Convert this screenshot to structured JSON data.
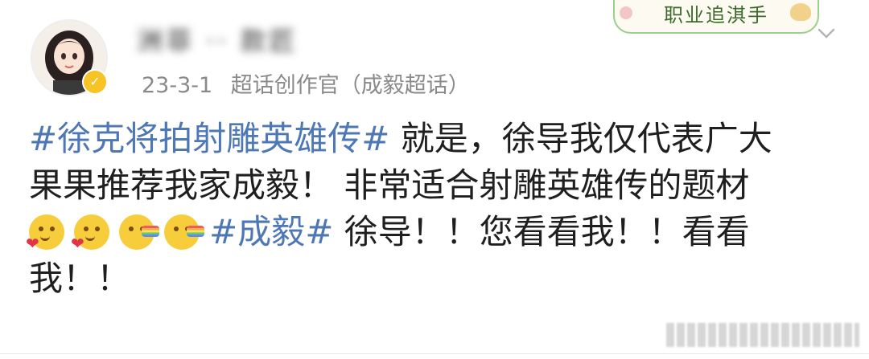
{
  "post": {
    "username": "洲菲 ·· 款匠",
    "date": "23-3-1",
    "role": "超话创作官（成毅超话）",
    "badge": "职业追淇手",
    "lines": [
      [
        {
          "t": "topic",
          "v": "#徐克将拍射雕英雄传#"
        },
        {
          "t": "text",
          "v": " 就是，徐导我仅代表广大"
        }
      ],
      [
        {
          "t": "text",
          "v": "果果推荐我家成毅！  非常适合射雕英雄传的题材"
        }
      ],
      [
        {
          "t": "emoji",
          "v": "heart-face-emoji"
        },
        {
          "t": "emoji",
          "v": "heart-face-emoji"
        },
        {
          "t": "emoji",
          "v": "rainbow-puke-emoji"
        },
        {
          "t": "emoji",
          "v": "rainbow-puke-emoji"
        },
        {
          "t": "topic",
          "v": "#成毅#"
        },
        {
          "t": "text",
          "v": " 徐导！！您看看我！！看看"
        }
      ],
      [
        {
          "t": "text",
          "v": "我！！"
        }
      ]
    ]
  },
  "icons": {
    "verified": "verified-badge-icon",
    "more": "chevron-down-icon"
  },
  "colors": {
    "topic": "#4d78b5",
    "meta": "#8a8a8a",
    "verified": "#f7c325",
    "badge_border": "#9bcf8e"
  }
}
